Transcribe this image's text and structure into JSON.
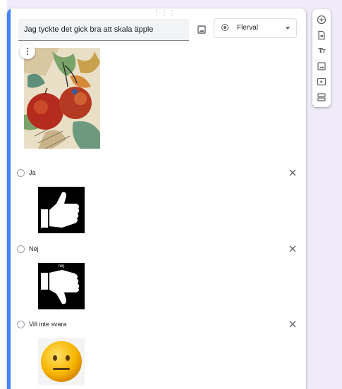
{
  "question": {
    "title": "Jag tyckte det gick bra att skala äpple",
    "type_label": "Flerval"
  },
  "icons": {
    "drag": "drag-handle-icon",
    "add_image": "image-icon",
    "close": "close-icon",
    "more": "more-vert-icon"
  },
  "options": [
    {
      "label": "Ja",
      "image": "thumbs-up"
    },
    {
      "label": "Nej",
      "image": "thumbs-down",
      "image_caption": "nej"
    },
    {
      "label": "Vill inte svara",
      "image": "neutral-face"
    }
  ],
  "toolbar": [
    {
      "name": "add-question",
      "icon": "plus-circle-icon"
    },
    {
      "name": "import-questions",
      "icon": "import-icon"
    },
    {
      "name": "add-title-description",
      "icon": "title-icon",
      "text": "T",
      "text_small": "T"
    },
    {
      "name": "add-image",
      "icon": "image-icon"
    },
    {
      "name": "add-video",
      "icon": "video-icon"
    },
    {
      "name": "add-section",
      "icon": "section-icon"
    }
  ],
  "colors": {
    "accent": "#4285f4",
    "background": "#f0ebf8",
    "icon": "#5f6368"
  }
}
